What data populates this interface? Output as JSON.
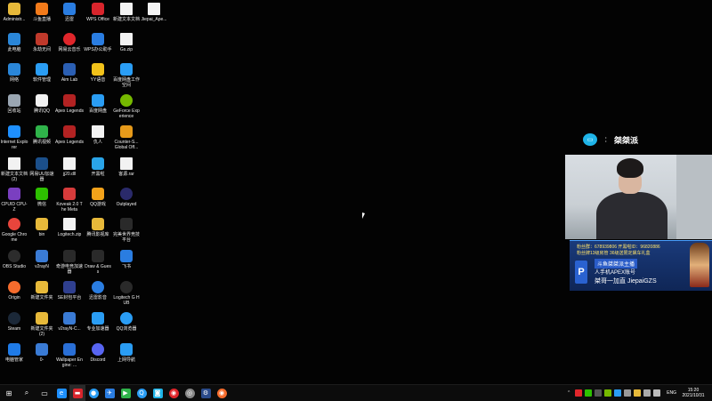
{
  "desktop_icons": [
    {
      "label": "Administr...",
      "icon": "user-folder-icon",
      "color": "#e7b93a",
      "col": 0,
      "row": 0
    },
    {
      "label": "此电脑",
      "icon": "computer-icon",
      "color": "#2a86d8",
      "col": 0,
      "row": 1
    },
    {
      "label": "网络",
      "icon": "network-icon",
      "color": "#2a86d8",
      "col": 0,
      "row": 2
    },
    {
      "label": "回收站",
      "icon": "recycle-bin-icon",
      "color": "#9aa6b2",
      "col": 0,
      "row": 3
    },
    {
      "label": "Internet Explorer",
      "icon": "internet-explorer-icon",
      "color": "#1e90ff",
      "col": 0,
      "row": 4
    },
    {
      "label": "新建文本文档 (2)",
      "icon": "text-file-icon",
      "color": "#f2f2f2",
      "col": 0,
      "row": 5
    },
    {
      "label": "CPUID CPU-Z",
      "icon": "cpuz-icon",
      "color": "#7a3fc0",
      "col": 0,
      "row": 6
    },
    {
      "label": "Google Chrome",
      "icon": "chrome-icon",
      "color": "#e8453c",
      "col": 0,
      "row": 7
    },
    {
      "label": "OBS Studio",
      "icon": "obs-icon",
      "color": "#2c2c2c",
      "col": 0,
      "row": 8
    },
    {
      "label": "Origin",
      "icon": "origin-icon",
      "color": "#f56c2d",
      "col": 0,
      "row": 9
    },
    {
      "label": "Steam",
      "icon": "steam-icon",
      "color": "#1b2838",
      "col": 0,
      "row": 10
    },
    {
      "label": "电脑管家",
      "icon": "pc-manager-icon",
      "color": "#1f7be8",
      "col": 0,
      "row": 11
    },
    {
      "label": "斗鱼直播",
      "icon": "douyu-icon",
      "color": "#f27a1a",
      "col": 1,
      "row": 0
    },
    {
      "label": "永劫无间",
      "icon": "naraka-icon",
      "color": "#c0392b",
      "col": 1,
      "row": 1
    },
    {
      "label": "软件管理",
      "icon": "software-manager-icon",
      "color": "#2a9df4",
      "col": 1,
      "row": 2
    },
    {
      "label": "腾讯QQ",
      "icon": "qq-icon",
      "color": "#f2f2f2",
      "col": 1,
      "row": 3
    },
    {
      "label": "腾讯视频",
      "icon": "tencent-video-icon",
      "color": "#2fb34a",
      "col": 1,
      "row": 4
    },
    {
      "label": "网易UU加速器",
      "icon": "uu-accelerator-icon",
      "color": "#1b4f8a",
      "col": 1,
      "row": 5
    },
    {
      "label": "微信",
      "icon": "wechat-icon",
      "color": "#2dc100",
      "col": 1,
      "row": 6
    },
    {
      "label": "bin",
      "icon": "folder-icon",
      "color": "#e7b93a",
      "col": 1,
      "row": 7
    },
    {
      "label": "v2rayN",
      "icon": "v2rayn-icon",
      "color": "#3a7bd5",
      "col": 1,
      "row": 8
    },
    {
      "label": "新建文件夹",
      "icon": "folder-icon",
      "color": "#e7b93a",
      "col": 1,
      "row": 9
    },
    {
      "label": "新建文件夹 (2)",
      "icon": "folder-icon",
      "color": "#e7b93a",
      "col": 1,
      "row": 10
    },
    {
      "label": "0-",
      "icon": "app-icon",
      "color": "#3a7bd5",
      "col": 1,
      "row": 11
    },
    {
      "label": "迅雷",
      "icon": "thunder-icon",
      "color": "#2a7de1",
      "col": 2,
      "row": 0
    },
    {
      "label": "网易云音乐",
      "icon": "netease-music-icon",
      "color": "#e0262b",
      "col": 2,
      "row": 1
    },
    {
      "label": "Aim Lab",
      "icon": "aimlab-icon",
      "color": "#2b5fb3",
      "col": 2,
      "row": 2
    },
    {
      "label": "Apex Legends",
      "icon": "apex-icon",
      "color": "#b22222",
      "col": 2,
      "row": 3
    },
    {
      "label": "Apex Legends",
      "icon": "apex-icon",
      "color": "#b22222",
      "col": 2,
      "row": 4
    },
    {
      "label": "jj20.dll",
      "icon": "dll-file-icon",
      "color": "#f2f2f2",
      "col": 2,
      "row": 5
    },
    {
      "label": "Koveak 2.0 The Meta",
      "icon": "koveak-icon",
      "color": "#d63b3b",
      "col": 2,
      "row": 6
    },
    {
      "label": "Logitech.zip",
      "icon": "zip-file-icon",
      "color": "#f2f2f2",
      "col": 2,
      "row": 7
    },
    {
      "label": "奇游电竞加速器",
      "icon": "qiyou-icon",
      "color": "#2a2a2a",
      "col": 2,
      "row": 8
    },
    {
      "label": "SE封包平台",
      "icon": "se-icon",
      "color": "#2f3f8f",
      "col": 2,
      "row": 9
    },
    {
      "label": "v2rayN-C...",
      "icon": "v2rayn-icon",
      "color": "#3a7bd5",
      "col": 2,
      "row": 10
    },
    {
      "label": "Wallpaper Engine: ...",
      "icon": "wallpaper-engine-icon",
      "color": "#2a6fd6",
      "col": 2,
      "row": 11
    },
    {
      "label": "WPS Office",
      "icon": "wps-icon",
      "color": "#d8252c",
      "col": 3,
      "row": 0
    },
    {
      "label": "WPS办公助手",
      "icon": "wps-assistant-icon",
      "color": "#2a7de1",
      "col": 3,
      "row": 1
    },
    {
      "label": "YY语音",
      "icon": "yy-icon",
      "color": "#f2c21a",
      "col": 3,
      "row": 2
    },
    {
      "label": "百度网盘",
      "icon": "baidu-netdisk-icon",
      "color": "#2a9df4",
      "col": 3,
      "row": 3
    },
    {
      "label": "仇人",
      "icon": "text-file-icon",
      "color": "#f2f2f2",
      "col": 3,
      "row": 4
    },
    {
      "label": "开黑啦",
      "icon": "kaiheila-icon",
      "color": "#2aa4e8",
      "col": 3,
      "row": 5
    },
    {
      "label": "QQ游戏",
      "icon": "qq-game-icon",
      "color": "#f2a21a",
      "col": 3,
      "row": 6
    },
    {
      "label": "腾讯影视库",
      "icon": "folder-icon",
      "color": "#e7b93a",
      "col": 3,
      "row": 7
    },
    {
      "label": "Draw & Guess",
      "icon": "draw-guess-icon",
      "color": "#2a2a2a",
      "col": 3,
      "row": 8
    },
    {
      "label": "迅雷影音",
      "icon": "thunder-player-icon",
      "color": "#2a7de1",
      "col": 3,
      "row": 9
    },
    {
      "label": "专业加速器",
      "icon": "accelerator-icon",
      "color": "#2a9df4",
      "col": 3,
      "row": 10
    },
    {
      "label": "Discord",
      "icon": "discord-icon",
      "color": "#5865f2",
      "col": 3,
      "row": 11
    },
    {
      "label": "新建文本文档",
      "icon": "text-file-icon",
      "color": "#f2f2f2",
      "col": 4,
      "row": 0
    },
    {
      "label": "Gs.zip",
      "icon": "zip-file-icon",
      "color": "#f2f2f2",
      "col": 4,
      "row": 1
    },
    {
      "label": "百度网盘工作空间",
      "icon": "baidu-workspace-icon",
      "color": "#2a9df4",
      "col": 4,
      "row": 2
    },
    {
      "label": "GeForce Experience",
      "icon": "geforce-icon",
      "color": "#76b900",
      "col": 4,
      "row": 3
    },
    {
      "label": "Counter-S... Global Off...",
      "icon": "csgo-icon",
      "color": "#e69a1a",
      "col": 4,
      "row": 4
    },
    {
      "label": "客源.rar",
      "icon": "rar-file-icon",
      "color": "#f2f2f2",
      "col": 4,
      "row": 5
    },
    {
      "label": "Outplayed",
      "icon": "outplayed-icon",
      "color": "#2a2a6a",
      "col": 4,
      "row": 6
    },
    {
      "label": "完美世界竞技平台",
      "icon": "perfect-world-icon",
      "color": "#2a2a2a",
      "col": 4,
      "row": 7
    },
    {
      "label": "飞书",
      "icon": "feishu-icon",
      "color": "#2a7de1",
      "col": 4,
      "row": 8
    },
    {
      "label": "Logitech G HUB",
      "icon": "logitech-ghub-icon",
      "color": "#2a2a2a",
      "col": 4,
      "row": 9
    },
    {
      "label": "QQ浏览器",
      "icon": "qq-browser-icon",
      "color": "#2a9df4",
      "col": 4,
      "row": 10
    },
    {
      "label": "上网导航",
      "icon": "ie-nav-icon",
      "color": "#2a9df4",
      "col": 4,
      "row": 11
    },
    {
      "label": "Jiepai_Ape...",
      "icon": "text-file-icon",
      "color": "#f2f2f2",
      "col": 5,
      "row": 0
    }
  ],
  "overlay": {
    "streamer_name": "桀桀派",
    "separator": "：",
    "card_line1": "粉丝群：678939806   开黑啦ID：96820886",
    "card_line2": "粉丝牌13级房管   36级送限定飙车礼盒",
    "card_line3": "斗鱼桀桀派主播",
    "card_line4": "人手机APEX账号",
    "card_line5": "桀哥一加直   JiepaiGZS",
    "logo_text": "P"
  },
  "taskbar": {
    "items": [
      {
        "name": "start-button",
        "glyph": "⊞",
        "color": "#ffffff"
      },
      {
        "name": "search-icon",
        "glyph": "⌕",
        "color": "#ffffff"
      },
      {
        "name": "task-view-icon",
        "glyph": "▭",
        "color": "#ffffff"
      },
      {
        "name": "taskbar-internet-explorer",
        "glyph": "e",
        "color": "#1e90ff"
      },
      {
        "name": "taskbar-douyu-stream",
        "glyph": "▬",
        "color": "#d8252c"
      },
      {
        "name": "taskbar-thunder-player",
        "glyph": "●",
        "color": "#2a9df4"
      },
      {
        "name": "taskbar-thunder",
        "glyph": "✈",
        "color": "#2a7de1"
      },
      {
        "name": "taskbar-tencent-video",
        "glyph": "▶",
        "color": "#2fb34a"
      },
      {
        "name": "taskbar-qq-browser",
        "glyph": "Q",
        "color": "#2a9df4"
      },
      {
        "name": "taskbar-kaiheila",
        "glyph": "◙",
        "color": "#1fb4e8"
      },
      {
        "name": "taskbar-netease-music",
        "glyph": "◉",
        "color": "#e0262b"
      },
      {
        "name": "taskbar-obs",
        "glyph": "◎",
        "color": "#888888"
      },
      {
        "name": "taskbar-steam",
        "glyph": "⚙",
        "color": "#2a4a8a"
      },
      {
        "name": "taskbar-origin",
        "glyph": "◉",
        "color": "#f56c2d"
      }
    ],
    "lang": "ENG",
    "time": "15:20",
    "date": "2021/10/31"
  }
}
